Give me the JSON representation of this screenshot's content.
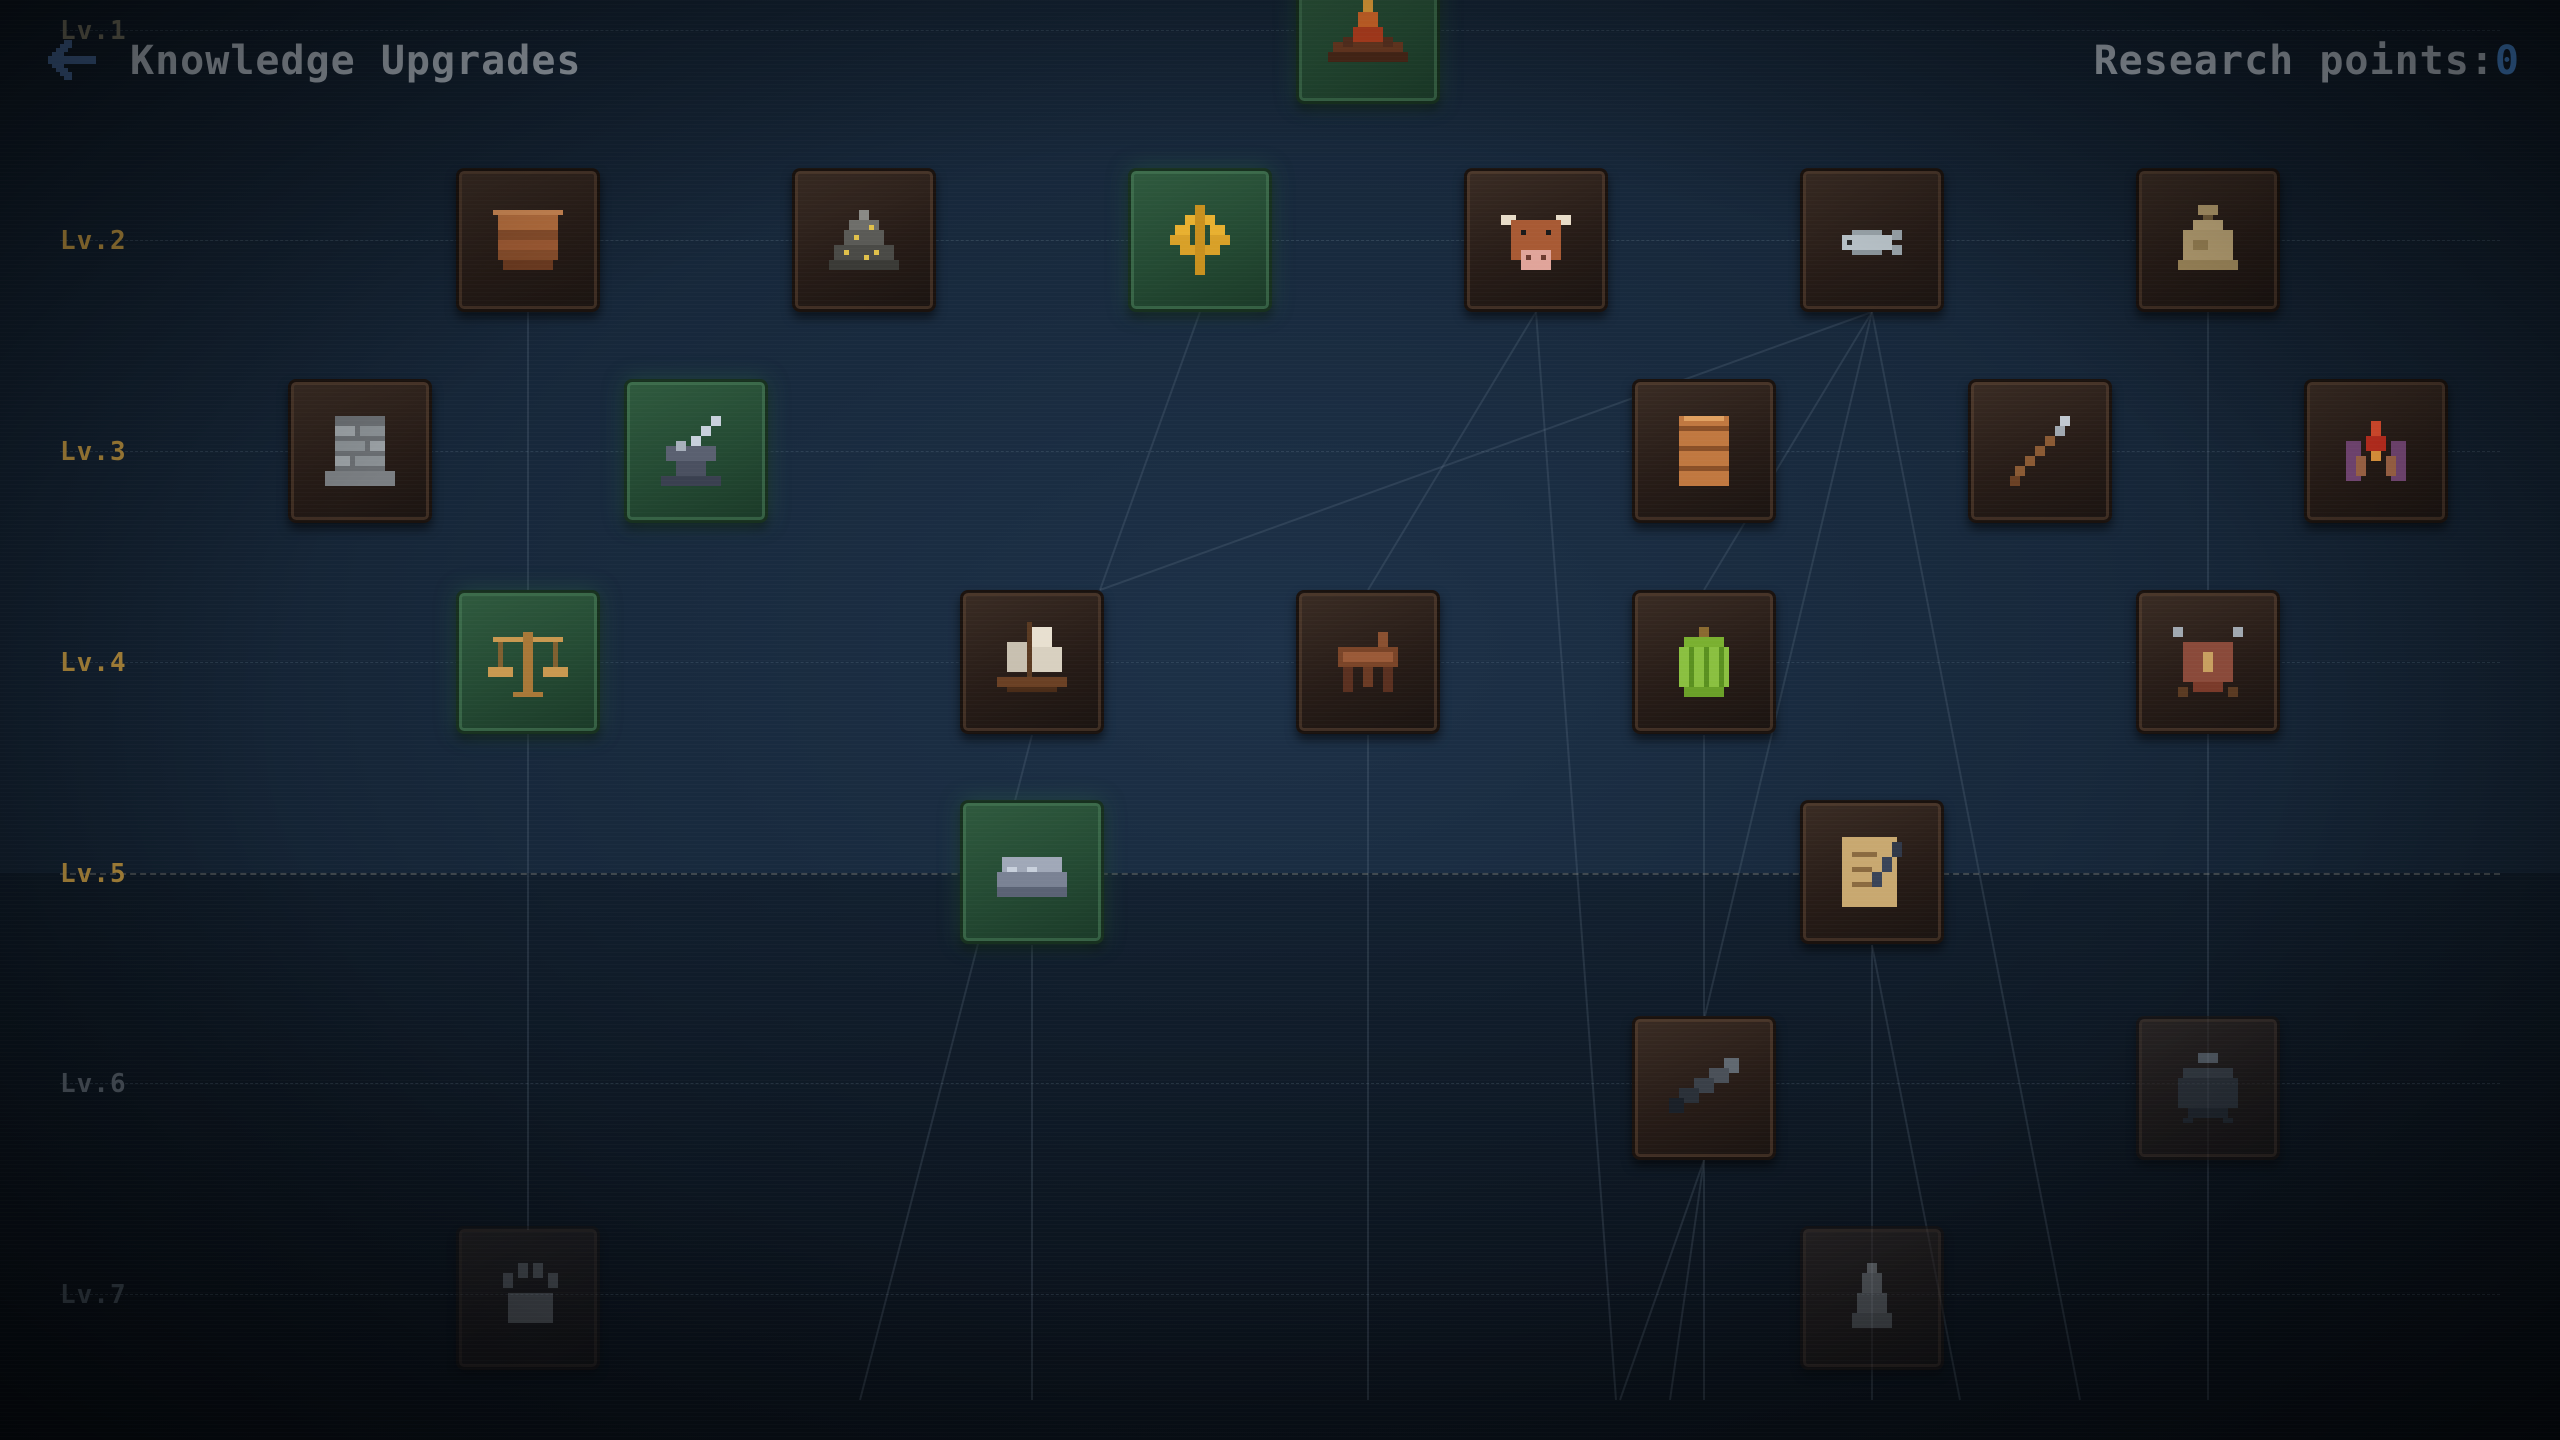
{
  "header": {
    "title": "Knowledge Upgrades",
    "research_points_label": "Research points:",
    "research_points_value": "0"
  },
  "levels": [
    {
      "label": "Lv.1",
      "color": "#6c6a5a"
    },
    {
      "label": "Lv.2",
      "color": "#b08a3c"
    },
    {
      "label": "Lv.3",
      "color": "#b08a3c"
    },
    {
      "label": "Lv.4",
      "color": "#b08a3c"
    },
    {
      "label": "Lv.5",
      "color": "#b08a3c"
    },
    {
      "label": "Lv.6",
      "color": "#4f5862"
    },
    {
      "label": "Lv.7",
      "color": "#36404a"
    }
  ],
  "upgrades": [
    {
      "name": "campfire",
      "level": 1,
      "icon": "campfire-icon",
      "state": "unlocked"
    },
    {
      "name": "basket",
      "level": 2,
      "icon": "wicker-basket-icon",
      "state": "locked"
    },
    {
      "name": "ore-pile",
      "level": 2,
      "icon": "ore-pile-icon",
      "state": "locked"
    },
    {
      "name": "wheat",
      "level": 2,
      "icon": "wheat-icon",
      "state": "unlocked"
    },
    {
      "name": "cattle",
      "level": 2,
      "icon": "cow-icon",
      "state": "locked"
    },
    {
      "name": "fishing",
      "level": 2,
      "icon": "fish-icon",
      "state": "locked"
    },
    {
      "name": "grain-sack",
      "level": 2,
      "icon": "sack-icon",
      "state": "locked"
    },
    {
      "name": "stone-wall",
      "level": 3,
      "icon": "stone-wall-icon",
      "state": "locked"
    },
    {
      "name": "smithing",
      "level": 3,
      "icon": "sword-anvil-icon",
      "state": "unlocked"
    },
    {
      "name": "storage-barrel",
      "level": 3,
      "icon": "barrel-icon",
      "state": "locked"
    },
    {
      "name": "spear",
      "level": 3,
      "icon": "spear-icon",
      "state": "locked"
    },
    {
      "name": "ritual",
      "level": 3,
      "icon": "flame-hands-icon",
      "state": "locked"
    },
    {
      "name": "trade-scales",
      "level": 4,
      "icon": "balance-scale-icon",
      "state": "unlocked"
    },
    {
      "name": "sailing",
      "level": 4,
      "icon": "sailing-ship-icon",
      "state": "locked"
    },
    {
      "name": "riding",
      "level": 4,
      "icon": "saddle-icon",
      "state": "locked"
    },
    {
      "name": "cactus-fruit",
      "level": 4,
      "icon": "green-melon-icon",
      "state": "locked"
    },
    {
      "name": "warfare",
      "level": 4,
      "icon": "shield-spears-icon",
      "state": "locked"
    },
    {
      "name": "iron-ingots",
      "level": 5,
      "icon": "iron-ingot-icon",
      "state": "unlocked"
    },
    {
      "name": "writing",
      "level": 5,
      "icon": "scroll-quill-icon",
      "state": "locked"
    },
    {
      "name": "astronomy",
      "level": 6,
      "icon": "telescope-icon",
      "state": "locked"
    },
    {
      "name": "cooking",
      "level": 6,
      "icon": "cauldron-icon",
      "state": "locked"
    },
    {
      "name": "taming",
      "level": 7,
      "icon": "paw-print-icon",
      "state": "locked"
    },
    {
      "name": "prayer",
      "level": 7,
      "icon": "praying-hands-icon",
      "state": "locked"
    }
  ]
}
